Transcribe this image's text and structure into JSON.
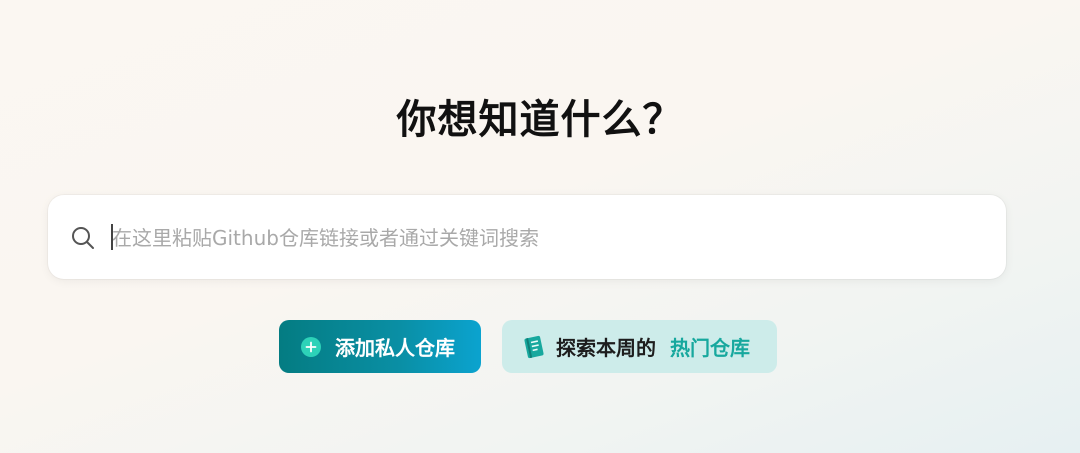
{
  "page": {
    "headline": "你想知道什么？"
  },
  "search": {
    "placeholder": "在这里粘贴Github仓库链接或者通过关键词搜索",
    "value": "",
    "icon": "search-icon"
  },
  "actions": {
    "add_private": {
      "label": "添加私人仓库",
      "icon": "plus-circle-icon"
    },
    "explore": {
      "label_prefix": "探索本周的",
      "label_highlight": "热门仓库",
      "icon": "book-icon"
    }
  },
  "colors": {
    "primary_gradient_start": "#047c82",
    "primary_gradient_end": "#0ba3cf",
    "accent_teal": "#17a89e",
    "secondary_bg": "#cdecea",
    "plus_circle": "#2dd2b8"
  }
}
